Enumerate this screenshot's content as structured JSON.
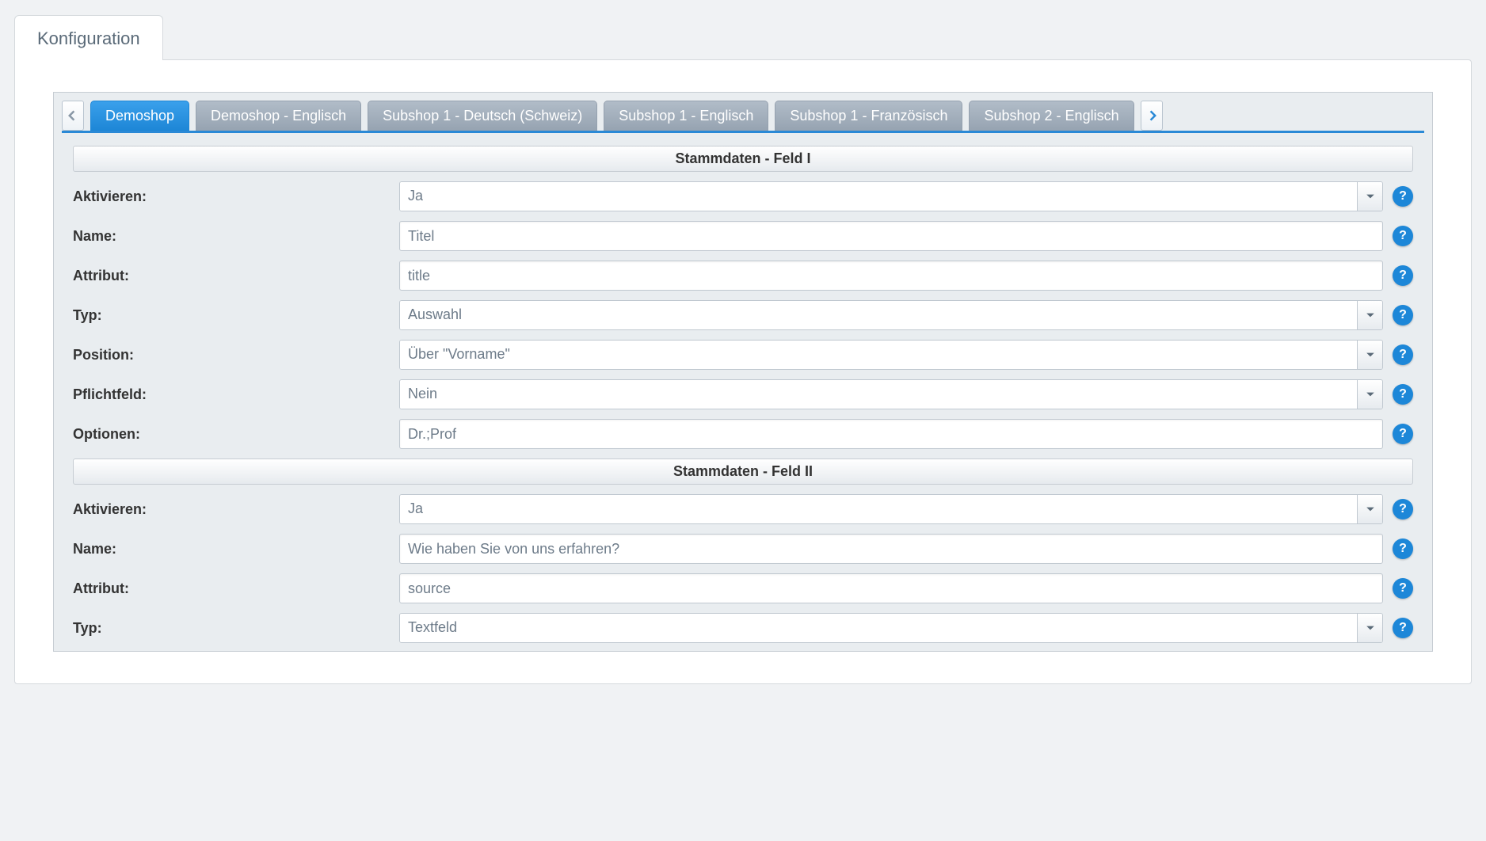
{
  "outerTab": {
    "label": "Konfiguration"
  },
  "shopTabs": {
    "items": [
      {
        "label": "Demoshop",
        "active": true
      },
      {
        "label": "Demoshop - Englisch",
        "active": false
      },
      {
        "label": "Subshop 1 - Deutsch (Schweiz)",
        "active": false
      },
      {
        "label": "Subshop 1 - Englisch",
        "active": false
      },
      {
        "label": "Subshop 1 - Französisch",
        "active": false
      },
      {
        "label": "Subshop 2 - Englisch",
        "active": false
      }
    ]
  },
  "section1": {
    "title": "Stammdaten - Feld I",
    "aktivieren_label": "Aktivieren:",
    "aktivieren_value": "Ja",
    "name_label": "Name:",
    "name_value": "Titel",
    "attribut_label": "Attribut:",
    "attribut_value": "title",
    "typ_label": "Typ:",
    "typ_value": "Auswahl",
    "position_label": "Position:",
    "position_value": "Über \"Vorname\"",
    "pflichtfeld_label": "Pflichtfeld:",
    "pflichtfeld_value": "Nein",
    "optionen_label": "Optionen:",
    "optionen_value": "Dr.;Prof"
  },
  "section2": {
    "title": "Stammdaten - Feld II",
    "aktivieren_label": "Aktivieren:",
    "aktivieren_value": "Ja",
    "name_label": "Name:",
    "name_value": "Wie haben Sie von uns erfahren?",
    "attribut_label": "Attribut:",
    "attribut_value": "source",
    "typ_label": "Typ:",
    "typ_value": "Textfeld"
  },
  "help_glyph": "?"
}
